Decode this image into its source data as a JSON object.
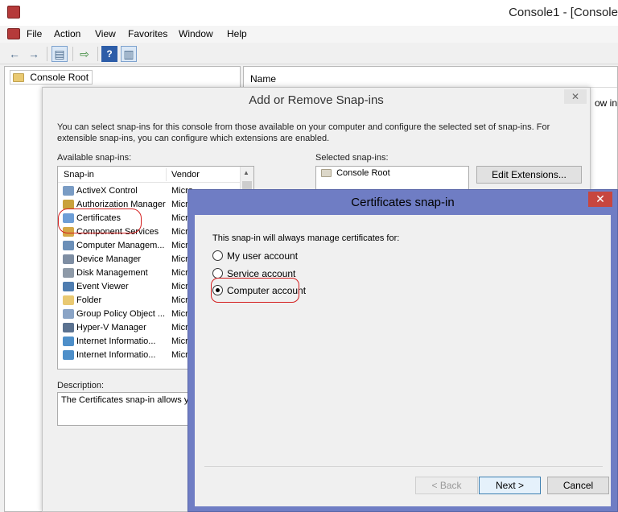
{
  "window": {
    "title": "Console1 - [Console"
  },
  "menu": [
    "File",
    "Action",
    "View",
    "Favorites",
    "Window",
    "Help"
  ],
  "toolbar": {
    "icons": [
      "back-icon",
      "forward-icon",
      "show-tree-icon",
      "export-list-icon",
      "help-icon",
      "show-action-pane-icon"
    ]
  },
  "tree": {
    "root": "Console Root"
  },
  "list": {
    "column_name": "Name",
    "partial_text": "ow in"
  },
  "add_remove": {
    "title": "Add or Remove Snap-ins",
    "intro": "You can select snap-ins for this console from those available on your computer and configure the selected set of snap-ins. For extensible snap-ins, you can configure which extensions are enabled.",
    "available_label": "Available snap-ins:",
    "selected_label": "Selected snap-ins:",
    "col_snapin": "Snap-in",
    "col_vendor": "Vendor",
    "snapins": [
      {
        "name": "ActiveX Control",
        "vendor": "Micro",
        "icon": "#7a9cc4"
      },
      {
        "name": "Authorization Manager",
        "vendor": "Micro",
        "icon": "#c9a23c"
      },
      {
        "name": "Certificates",
        "vendor": "Micro",
        "icon": "#6d9ed6"
      },
      {
        "name": "Component Services",
        "vendor": "Micro",
        "icon": "#d5a847"
      },
      {
        "name": "Computer Managem...",
        "vendor": "Micro",
        "icon": "#6b8fb8"
      },
      {
        "name": "Device Manager",
        "vendor": "Micro",
        "icon": "#7e8ea3"
      },
      {
        "name": "Disk Management",
        "vendor": "Micro",
        "icon": "#8e9aa8"
      },
      {
        "name": "Event Viewer",
        "vendor": "Micro",
        "icon": "#4f7db0"
      },
      {
        "name": "Folder",
        "vendor": "Micro",
        "icon": "#e9c972"
      },
      {
        "name": "Group Policy Object ...",
        "vendor": "Micro",
        "icon": "#8aa4c6"
      },
      {
        "name": "Hyper-V Manager",
        "vendor": "Micro",
        "icon": "#5b7290"
      },
      {
        "name": "Internet Informatio...",
        "vendor": "Micro",
        "icon": "#4e8fc9"
      },
      {
        "name": "Internet Informatio...",
        "vendor": "Micro",
        "icon": "#4e8fc9"
      }
    ],
    "selected": [
      "Console Root"
    ],
    "edit_extensions": "Edit Extensions...",
    "description_label": "Description:",
    "description_text": "The Certificates snap-in allows yo",
    "close_glyph": "✕"
  },
  "cert_dialog": {
    "title": "Certificates snap-in",
    "prompt": "This snap-in will always manage certificates for:",
    "options": [
      {
        "label": "My user account",
        "selected": false
      },
      {
        "label": "Service account",
        "selected": false
      },
      {
        "label": "Computer account",
        "selected": true
      }
    ],
    "back": "< Back",
    "next": "Next >",
    "cancel": "Cancel",
    "close_glyph": "✕"
  },
  "colors": {
    "accent": "#6f7dc4",
    "close_red": "#c7463f",
    "callout": "#d41f1f"
  }
}
